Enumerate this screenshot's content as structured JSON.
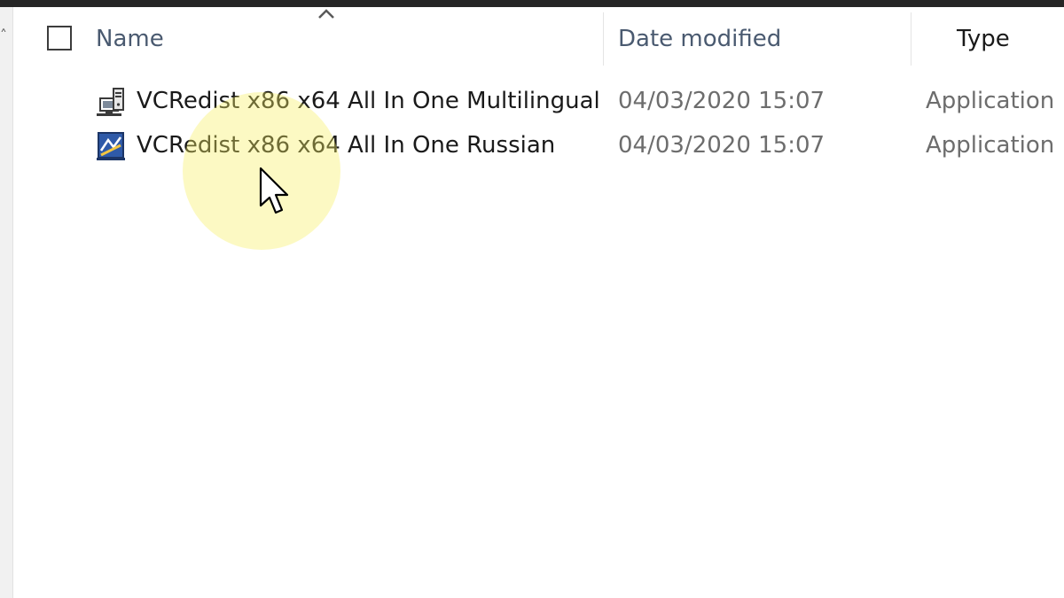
{
  "columns": {
    "name": "Name",
    "date_modified": "Date modified",
    "type": "Type"
  },
  "sort": {
    "column": "name",
    "direction": "ascending",
    "icon": "sort-ascending-icon"
  },
  "files": [
    {
      "name": "VCRedist x86 x64 All In One Multilingual",
      "date_modified": "04/03/2020 15:07",
      "type": "Application",
      "icon": "installer-computer-icon"
    },
    {
      "name": "VCRedist x86 x64 All In One Russian",
      "date_modified": "04/03/2020 15:07",
      "type": "Application",
      "icon": "installer-blue-icon"
    }
  ],
  "colors": {
    "header_text": "#4a5a70",
    "secondary_text": "#6d6d6d",
    "cursor_highlight": "#f6f060"
  }
}
